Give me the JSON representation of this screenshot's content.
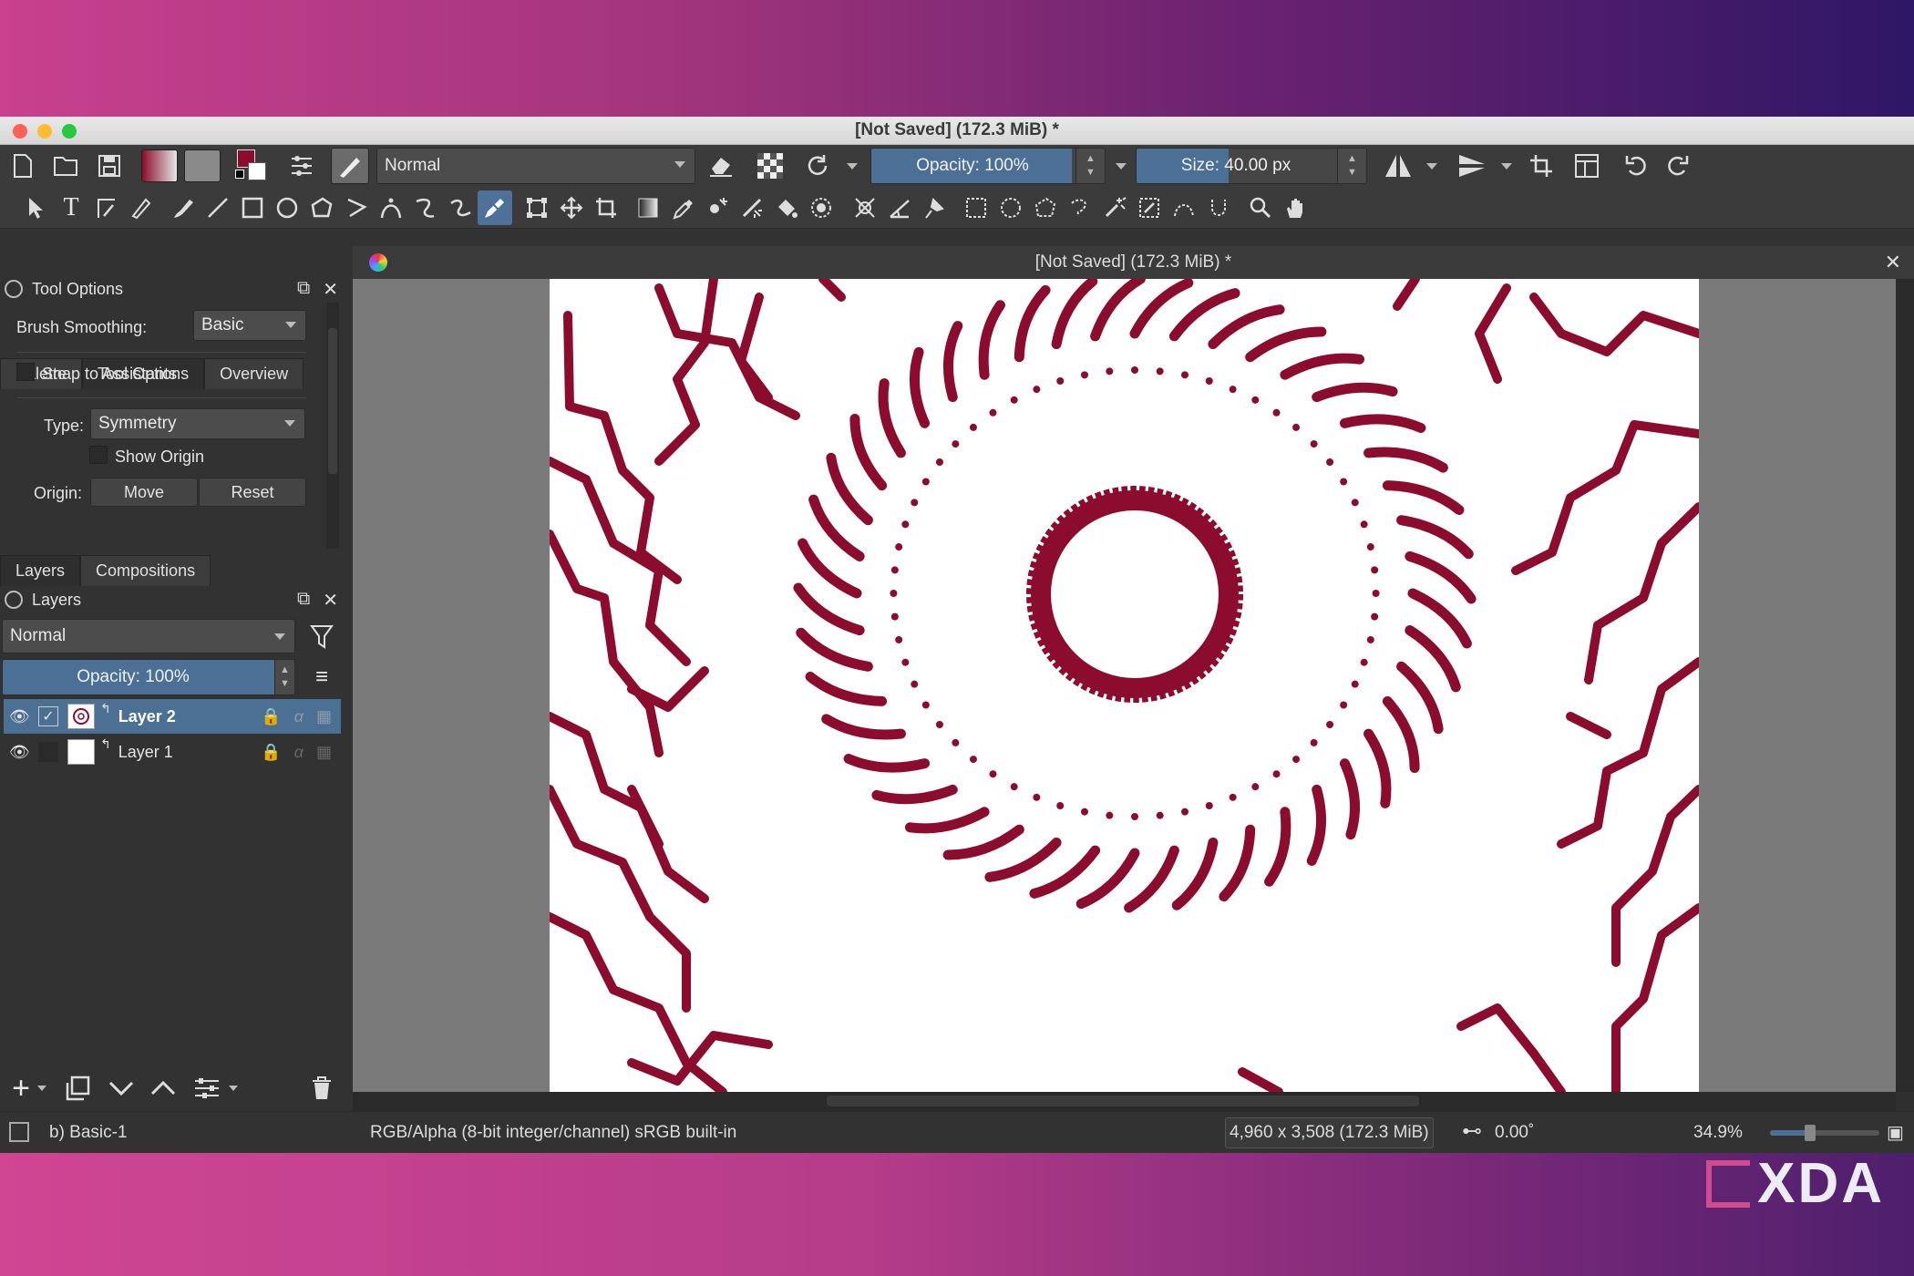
{
  "window": {
    "title": "[Not Saved]  (172.3 MiB) *"
  },
  "colors": {
    "accent": "#4b6f95",
    "stroke": "#8b0c2e",
    "fg": "#8b0c2e",
    "bg": "#ffffff"
  },
  "toolbar": {
    "blend_mode": "Normal",
    "opacity": {
      "label": "Opacity: 100%",
      "value": 1.0
    },
    "size": {
      "label": "Size: 40.00 px",
      "value": 0.4
    }
  },
  "left_tabs": [
    "Palette",
    "Tool Options",
    "Overview"
  ],
  "tool_options": {
    "title": "Tool Options",
    "brush_smoothing_label": "Brush Smoothing:",
    "brush_smoothing_value": "Basic",
    "snap_label": "Snap to Assistants",
    "type_label": "Type:",
    "type_value": "Symmetry",
    "show_origin_label": "Show Origin",
    "origin_label": "Origin:",
    "move_label": "Move",
    "reset_label": "Reset"
  },
  "layer_tabs": [
    "Layers",
    "Compositions"
  ],
  "layers": {
    "title": "Layers",
    "blend_mode": "Normal",
    "opacity_label": "Opacity:  100%",
    "items": [
      {
        "name": "Layer 2",
        "selected": true,
        "visible": true
      },
      {
        "name": "Layer 1",
        "selected": false,
        "visible": true
      }
    ]
  },
  "document_tab": "[Not Saved]  (172.3 MiB) *",
  "status": {
    "brush": "b) Basic-1",
    "color_space": "RGB/Alpha (8-bit integer/channel)  sRGB built-in",
    "dimensions": "4,960 x 3,508 (172.3 MiB)",
    "rotation": "0.00˚",
    "zoom": "34.9%"
  },
  "watermark": "XDA"
}
